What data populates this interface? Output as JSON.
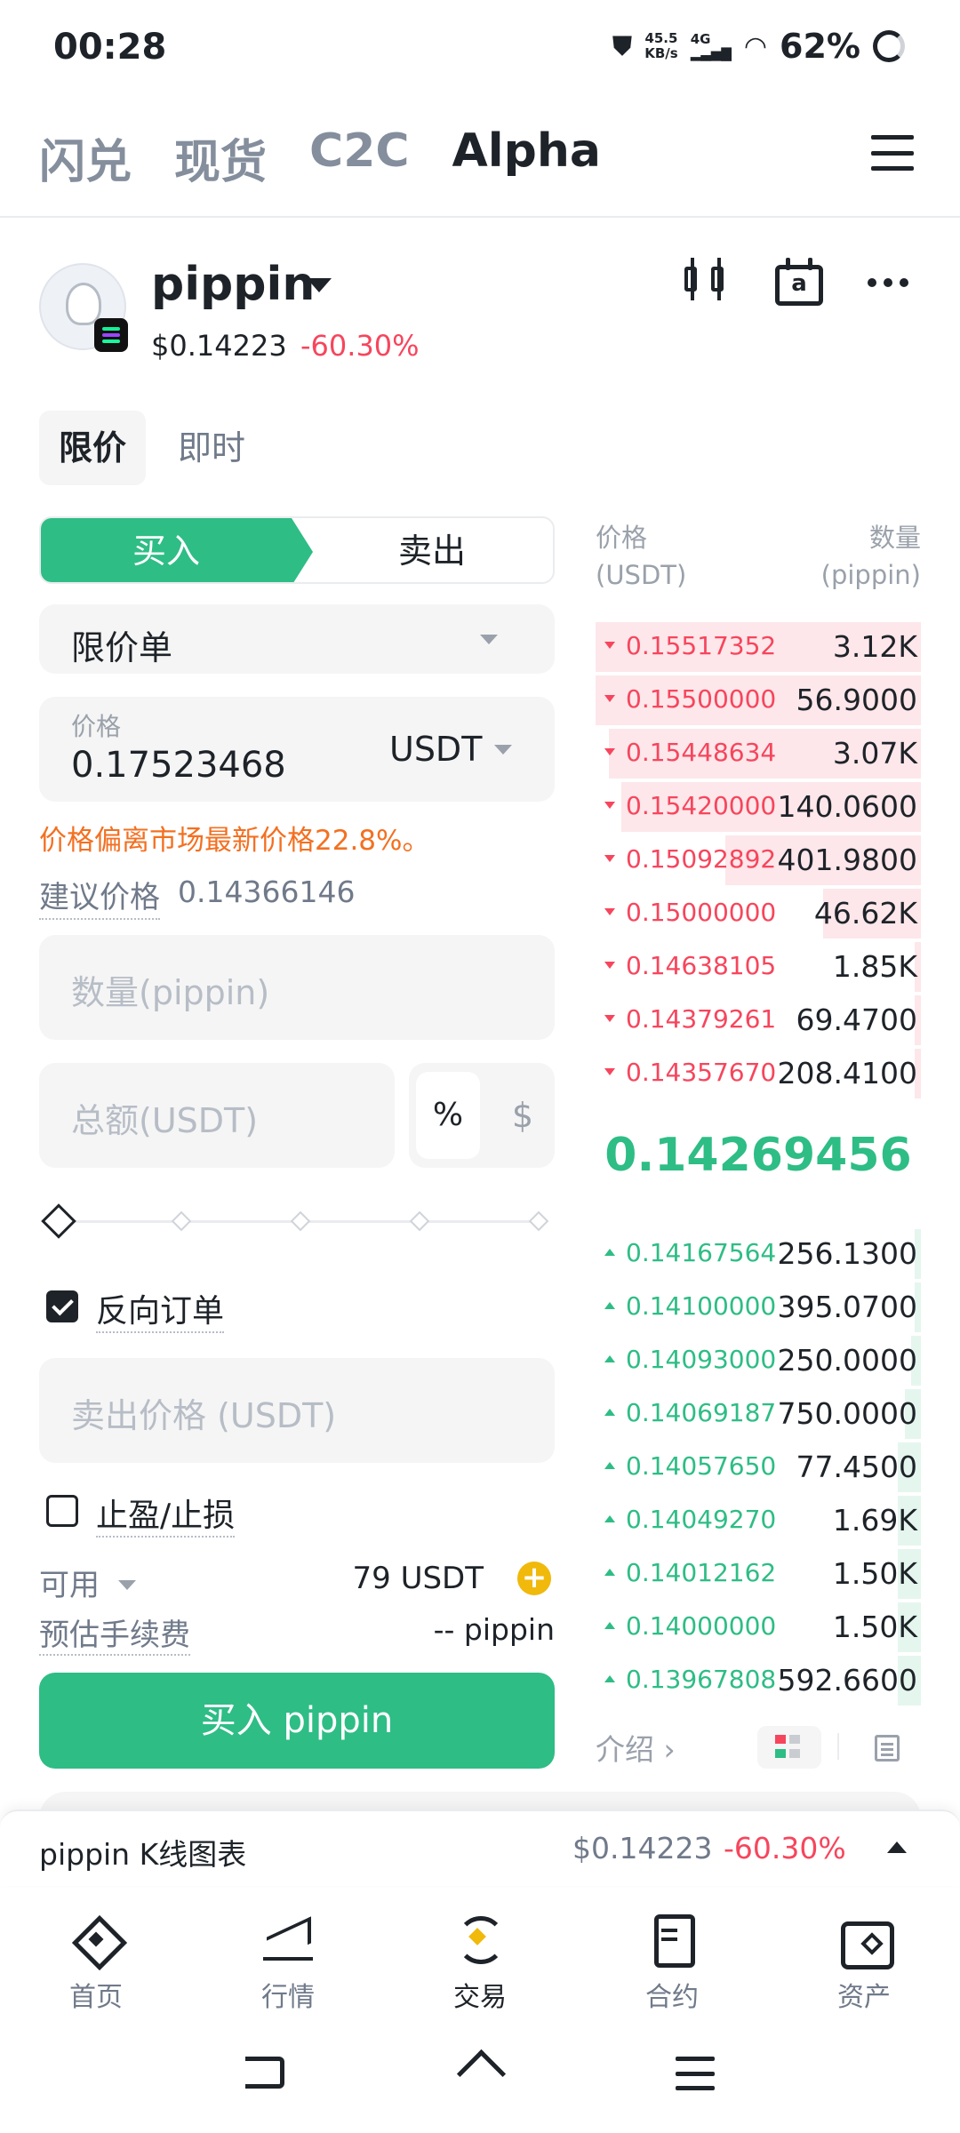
{
  "status_bar": {
    "time": "00:28",
    "net_speed_value": "45.5",
    "net_speed_unit": "KB/s",
    "network": "4G",
    "battery": "62%"
  },
  "top_tabs": [
    "闪兑",
    "现货",
    "C2C",
    "Alpha"
  ],
  "active_top_tab": "Alpha",
  "token": {
    "name": "pippin",
    "price": "$0.14223",
    "change": "-60.30%",
    "calendar_letter": "a"
  },
  "order_tabs": [
    "限价",
    "即时"
  ],
  "side": {
    "buy": "买入",
    "sell": "卖出"
  },
  "order_type": "限价单",
  "price_field": {
    "label": "价格",
    "value": "0.17523468",
    "unit": "USDT"
  },
  "warning": "价格偏离市场最新价格22.8%。",
  "suggested": {
    "label": "建议价格",
    "value": "0.14366146"
  },
  "quantity_placeholder": "数量(pippin)",
  "total_placeholder": "总额(USDT)",
  "unit_toggle": {
    "percent": "%",
    "dollar": "$"
  },
  "slider_value_percent": 0,
  "reverse_order": {
    "label": "反向订单",
    "checked": true
  },
  "sell_price_placeholder": "卖出价格 (USDT)",
  "tp_sl": {
    "label": "止盈/止损",
    "checked": false
  },
  "available": {
    "label": "可用",
    "value": "79 USDT"
  },
  "fee": {
    "label": "预估手续费",
    "value": "-- pippin"
  },
  "buy_button": "买入 pippin",
  "orderbook": {
    "price_header": "价格",
    "price_unit": "(USDT)",
    "qty_header": "数量",
    "qty_unit": "(pippin)",
    "asks": [
      {
        "price": "0.15517352",
        "qty": "3.12K",
        "depth": 1.0
      },
      {
        "price": "0.15500000",
        "qty": "56.9000",
        "depth": 1.0
      },
      {
        "price": "0.15448634",
        "qty": "3.07K",
        "depth": 0.96
      },
      {
        "price": "0.15420000",
        "qty": "140.0600",
        "depth": 0.92
      },
      {
        "price": "0.15092892",
        "qty": "401.9800",
        "depth": 0.6
      },
      {
        "price": "0.15000000",
        "qty": "46.62K",
        "depth": 0.3
      },
      {
        "price": "0.14638105",
        "qty": "1.85K",
        "depth": 0.02
      },
      {
        "price": "0.14379261",
        "qty": "69.4700",
        "depth": 0.02
      },
      {
        "price": "0.14357670",
        "qty": "208.4100",
        "depth": 0.02
      }
    ],
    "mid_price": "0.14269456",
    "bids": [
      {
        "price": "0.14167564",
        "qty": "256.1300",
        "depth": 0.02
      },
      {
        "price": "0.14100000",
        "qty": "395.0700",
        "depth": 0.02
      },
      {
        "price": "0.14093000",
        "qty": "250.0000",
        "depth": 0.03
      },
      {
        "price": "0.14069187",
        "qty": "750.0000",
        "depth": 0.05
      },
      {
        "price": "0.14057650",
        "qty": "77.4500",
        "depth": 0.07
      },
      {
        "price": "0.14049270",
        "qty": "1.69K",
        "depth": 0.07
      },
      {
        "price": "0.14012162",
        "qty": "1.50K",
        "depth": 0.07
      },
      {
        "price": "0.14000000",
        "qty": "1.50K",
        "depth": 0.07
      },
      {
        "price": "0.13967808",
        "qty": "592.6600",
        "depth": 0.07
      }
    ]
  },
  "intro_link": "介绍 ›",
  "chart_bar": {
    "title": "pippin K线图表",
    "price": "$0.14223",
    "change": "-60.30%"
  },
  "bottom_nav": [
    {
      "label": "首页",
      "icon": "home-icon"
    },
    {
      "label": "行情",
      "icon": "market-chart-icon"
    },
    {
      "label": "交易",
      "icon": "trade-icon"
    },
    {
      "label": "合约",
      "icon": "futures-icon"
    },
    {
      "label": "资产",
      "icon": "wallet-icon"
    }
  ],
  "active_nav": "交易",
  "colors": {
    "buy": "#2ebd85",
    "sell": "#f6465d",
    "warning": "#f37021",
    "accent": "#f0b90b"
  }
}
